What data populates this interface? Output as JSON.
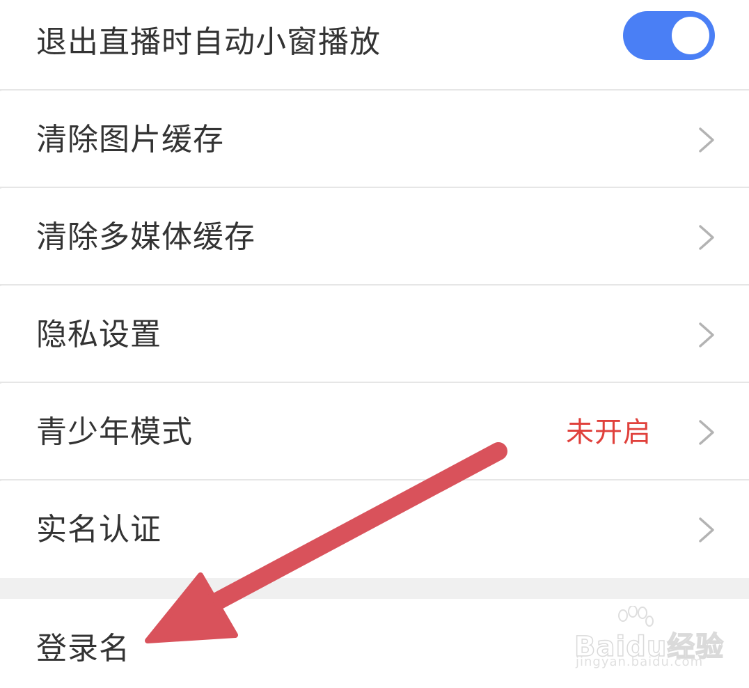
{
  "settings": {
    "items": [
      {
        "label": "退出直播时自动小窗播放",
        "control": "toggle",
        "toggle_on": true
      },
      {
        "label": "清除图片缓存",
        "control": "chevron"
      },
      {
        "label": "清除多媒体缓存",
        "control": "chevron"
      },
      {
        "label": "隐私设置",
        "control": "chevron"
      },
      {
        "label": "青少年模式",
        "control": "chevron",
        "status": "未开启"
      },
      {
        "label": "实名认证",
        "control": "chevron"
      }
    ],
    "login_row": {
      "label": "登录名"
    }
  },
  "annotation": {
    "arrow_color": "#d9525b",
    "points_to": "登录名"
  },
  "watermark": {
    "brand": "Baidu经验",
    "url": "jingyan.baidu.com"
  },
  "colors": {
    "toggle_on": "#4a7ff5",
    "status_text": "#e0413c",
    "chevron": "#b3b3b3",
    "section_gap": "#f0f0f0"
  }
}
